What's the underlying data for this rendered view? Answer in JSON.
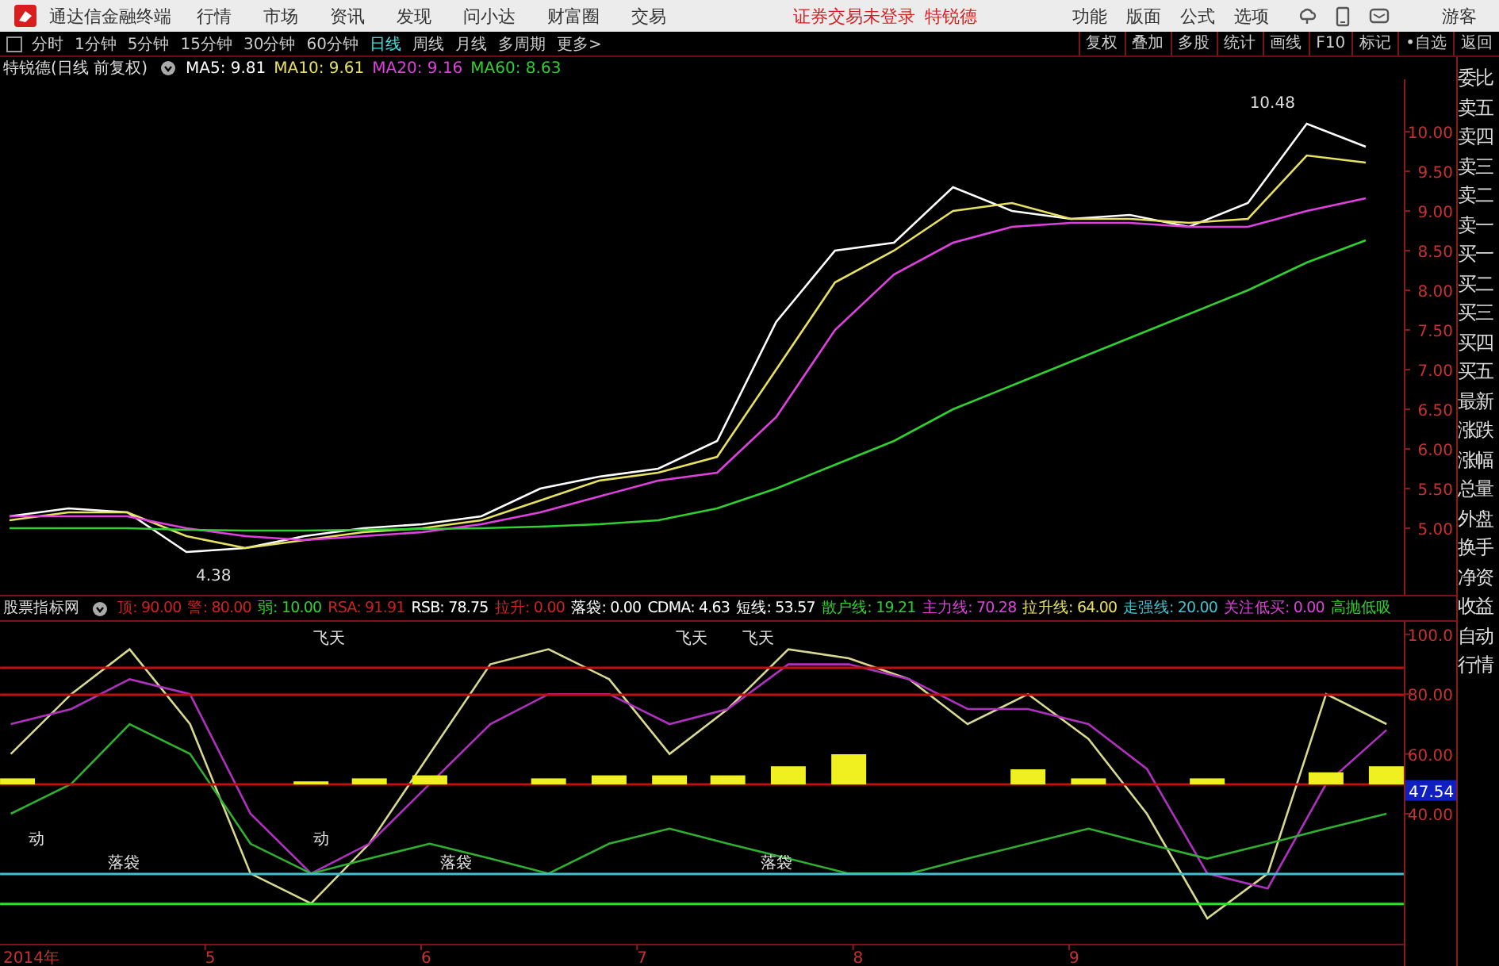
{
  "title_bar": {
    "app_name": "通达信金融终端",
    "menus": [
      "行情",
      "市场",
      "资讯",
      "发现",
      "问小达",
      "财富圈",
      "交易"
    ],
    "login_status": "证券交易未登录",
    "stock_name": "特锐德",
    "tools": [
      "功能",
      "版面",
      "公式",
      "选项"
    ],
    "user": "游客"
  },
  "period_bar": {
    "periods": [
      {
        "label": "分时",
        "selected": false
      },
      {
        "label": "1分钟",
        "selected": false
      },
      {
        "label": "5分钟",
        "selected": false
      },
      {
        "label": "15分钟",
        "selected": false
      },
      {
        "label": "30分钟",
        "selected": false
      },
      {
        "label": "60分钟",
        "selected": false
      },
      {
        "label": "日线",
        "selected": true
      },
      {
        "label": "周线",
        "selected": false
      },
      {
        "label": "月线",
        "selected": false
      },
      {
        "label": "多周期",
        "selected": false
      },
      {
        "label": "更多>",
        "selected": false
      }
    ],
    "actions": [
      "复权",
      "叠加",
      "多股",
      "统计",
      "画线",
      "F10",
      "标记",
      "•自选",
      "返回"
    ]
  },
  "main_chart": {
    "title": "特锐德(日线 前复权)",
    "legend": [
      {
        "label": "MA5: 9.81",
        "color": "#ffffff"
      },
      {
        "label": "MA10: 9.61",
        "color": "#e8e060"
      },
      {
        "label": "MA20: 9.16",
        "color": "#e040e0"
      },
      {
        "label": "MA60: 8.63",
        "color": "#30d030"
      }
    ],
    "chart_data": {
      "type": "line",
      "ylim": [
        4.16,
        10.66
      ],
      "yticks": [
        {
          "value": 5,
          "label": "5.00"
        },
        {
          "value": 5.5,
          "label": "5.50"
        },
        {
          "value": 6,
          "label": "6.00"
        },
        {
          "value": 6.5,
          "label": "6.50"
        },
        {
          "value": 7,
          "label": "7.00"
        },
        {
          "value": 7.5,
          "label": "7.50"
        },
        {
          "value": 8,
          "label": "8.00"
        },
        {
          "value": 8.5,
          "label": "8.50"
        },
        {
          "value": 9,
          "label": "9.00"
        },
        {
          "value": 9.5,
          "label": "9.50"
        },
        {
          "value": 10,
          "label": "10.00"
        }
      ],
      "series": [
        {
          "color": "#ffffff",
          "values": [
            5.15,
            5.25,
            5.2,
            4.7,
            4.75,
            4.9,
            5.0,
            5.05,
            5.15,
            5.5,
            5.65,
            5.75,
            6.1,
            7.6,
            8.5,
            8.6,
            9.3,
            9.0,
            8.9,
            8.95,
            8.8,
            9.1,
            10.1,
            9.81
          ]
        },
        {
          "color": "#e8e060",
          "values": [
            5.1,
            5.2,
            5.2,
            4.9,
            4.75,
            4.85,
            4.95,
            5.0,
            5.1,
            5.35,
            5.6,
            5.7,
            5.9,
            7.0,
            8.1,
            8.5,
            9.0,
            9.1,
            8.9,
            8.9,
            8.85,
            8.9,
            9.7,
            9.61
          ]
        },
        {
          "color": "#e040e0",
          "values": [
            5.15,
            5.15,
            5.15,
            5.0,
            4.9,
            4.85,
            4.9,
            4.95,
            5.05,
            5.2,
            5.4,
            5.6,
            5.7,
            6.4,
            7.5,
            8.2,
            8.6,
            8.8,
            8.85,
            8.85,
            8.8,
            8.8,
            9.0,
            9.16
          ]
        },
        {
          "color": "#30d030",
          "values": [
            5.0,
            5.0,
            5.0,
            4.98,
            4.97,
            4.97,
            4.98,
            4.99,
            5.0,
            5.02,
            5.05,
            5.1,
            5.25,
            5.5,
            5.8,
            6.1,
            6.5,
            6.8,
            7.1,
            7.4,
            7.7,
            8.0,
            8.35,
            8.63
          ]
        }
      ],
      "annotations": [
        "10.48",
        "4.38"
      ]
    }
  },
  "indicator": {
    "title": "股票指标网",
    "legend": [
      {
        "label": "顶: 90.00",
        "color": "#d02020"
      },
      {
        "label": "警: 80.00",
        "color": "#d02020"
      },
      {
        "label": "弱: 10.00",
        "color": "#30d030"
      },
      {
        "label": "RSA: 91.91",
        "color": "#d02020"
      },
      {
        "label": "RSB: 78.75",
        "color": "#ffffff"
      },
      {
        "label": "拉升: 0.00",
        "color": "#d02020"
      },
      {
        "label": "落袋: 0.00",
        "color": "#ffffff"
      },
      {
        "label": "CDMA: 4.63",
        "color": "#ffffff"
      },
      {
        "label": "短线: 53.57",
        "color": "#ffffff"
      },
      {
        "label": "散户线: 19.21",
        "color": "#30d030"
      },
      {
        "label": "主力线: 70.28",
        "color": "#e040e0"
      },
      {
        "label": "拉升线: 64.00",
        "color": "#e8e060"
      },
      {
        "label": "走强线: 20.00",
        "color": "#40c0d0"
      },
      {
        "label": "关注低买: 0.00",
        "color": "#e040e0"
      },
      {
        "label": "高抛低吸",
        "color": "#30d030"
      }
    ],
    "current_value": "47.54",
    "year_label": "2014年",
    "chart_data": {
      "type": "line",
      "x": [
        4.1,
        4.38,
        4.65,
        4.93,
        5.21,
        5.49,
        5.76,
        6.04,
        6.32,
        6.59,
        6.87,
        7.15,
        7.42,
        7.7,
        7.98,
        8.26,
        8.53,
        8.81,
        9.09,
        9.36,
        9.64,
        9.92,
        10.19,
        10.47
      ],
      "xlim": [
        4.05,
        10.55
      ],
      "ylim": [
        -3.5,
        104.2
      ],
      "xticks": [
        5,
        6,
        7,
        8,
        9
      ],
      "yticks": [
        {
          "value": 40,
          "label": "40.00"
        },
        {
          "value": 60,
          "label": "60.00"
        },
        {
          "value": 80,
          "label": "80.00"
        },
        {
          "value": 100,
          "label": "100.0"
        }
      ],
      "series": [
        {
          "color": "#d8d890",
          "values": [
            60,
            80,
            95,
            70,
            20,
            10,
            30,
            60,
            90,
            95,
            85,
            60,
            75,
            95,
            92,
            85,
            70,
            80,
            65,
            40,
            5,
            20,
            80,
            70
          ]
        },
        {
          "color": "#b030c0",
          "values": [
            70,
            75,
            85,
            80,
            40,
            20,
            30,
            50,
            70,
            80,
            80,
            70,
            75,
            90,
            90,
            85,
            75,
            75,
            70,
            55,
            20,
            15,
            50,
            68
          ]
        },
        {
          "color": "#30b030",
          "values": [
            40,
            50,
            70,
            60,
            30,
            20,
            25,
            30,
            25,
            20,
            30,
            35,
            30,
            25,
            20,
            20,
            25,
            30,
            35,
            30,
            25,
            30,
            35,
            40
          ]
        }
      ],
      "annotations": [
        "飞天",
        "飞天",
        "飞天",
        "动",
        "动",
        "落袋",
        "落袋",
        "落袋"
      ]
    }
  },
  "side_panel": {
    "items": [
      "委比",
      "卖五",
      "卖四",
      "卖三",
      "卖二",
      "卖一",
      "买一",
      "买二",
      "买三",
      "买四",
      "买五",
      "最新",
      "涨跌",
      "涨幅",
      "总量",
      "外盘",
      "换手",
      "净资",
      "收益",
      "自动",
      "行情"
    ]
  }
}
